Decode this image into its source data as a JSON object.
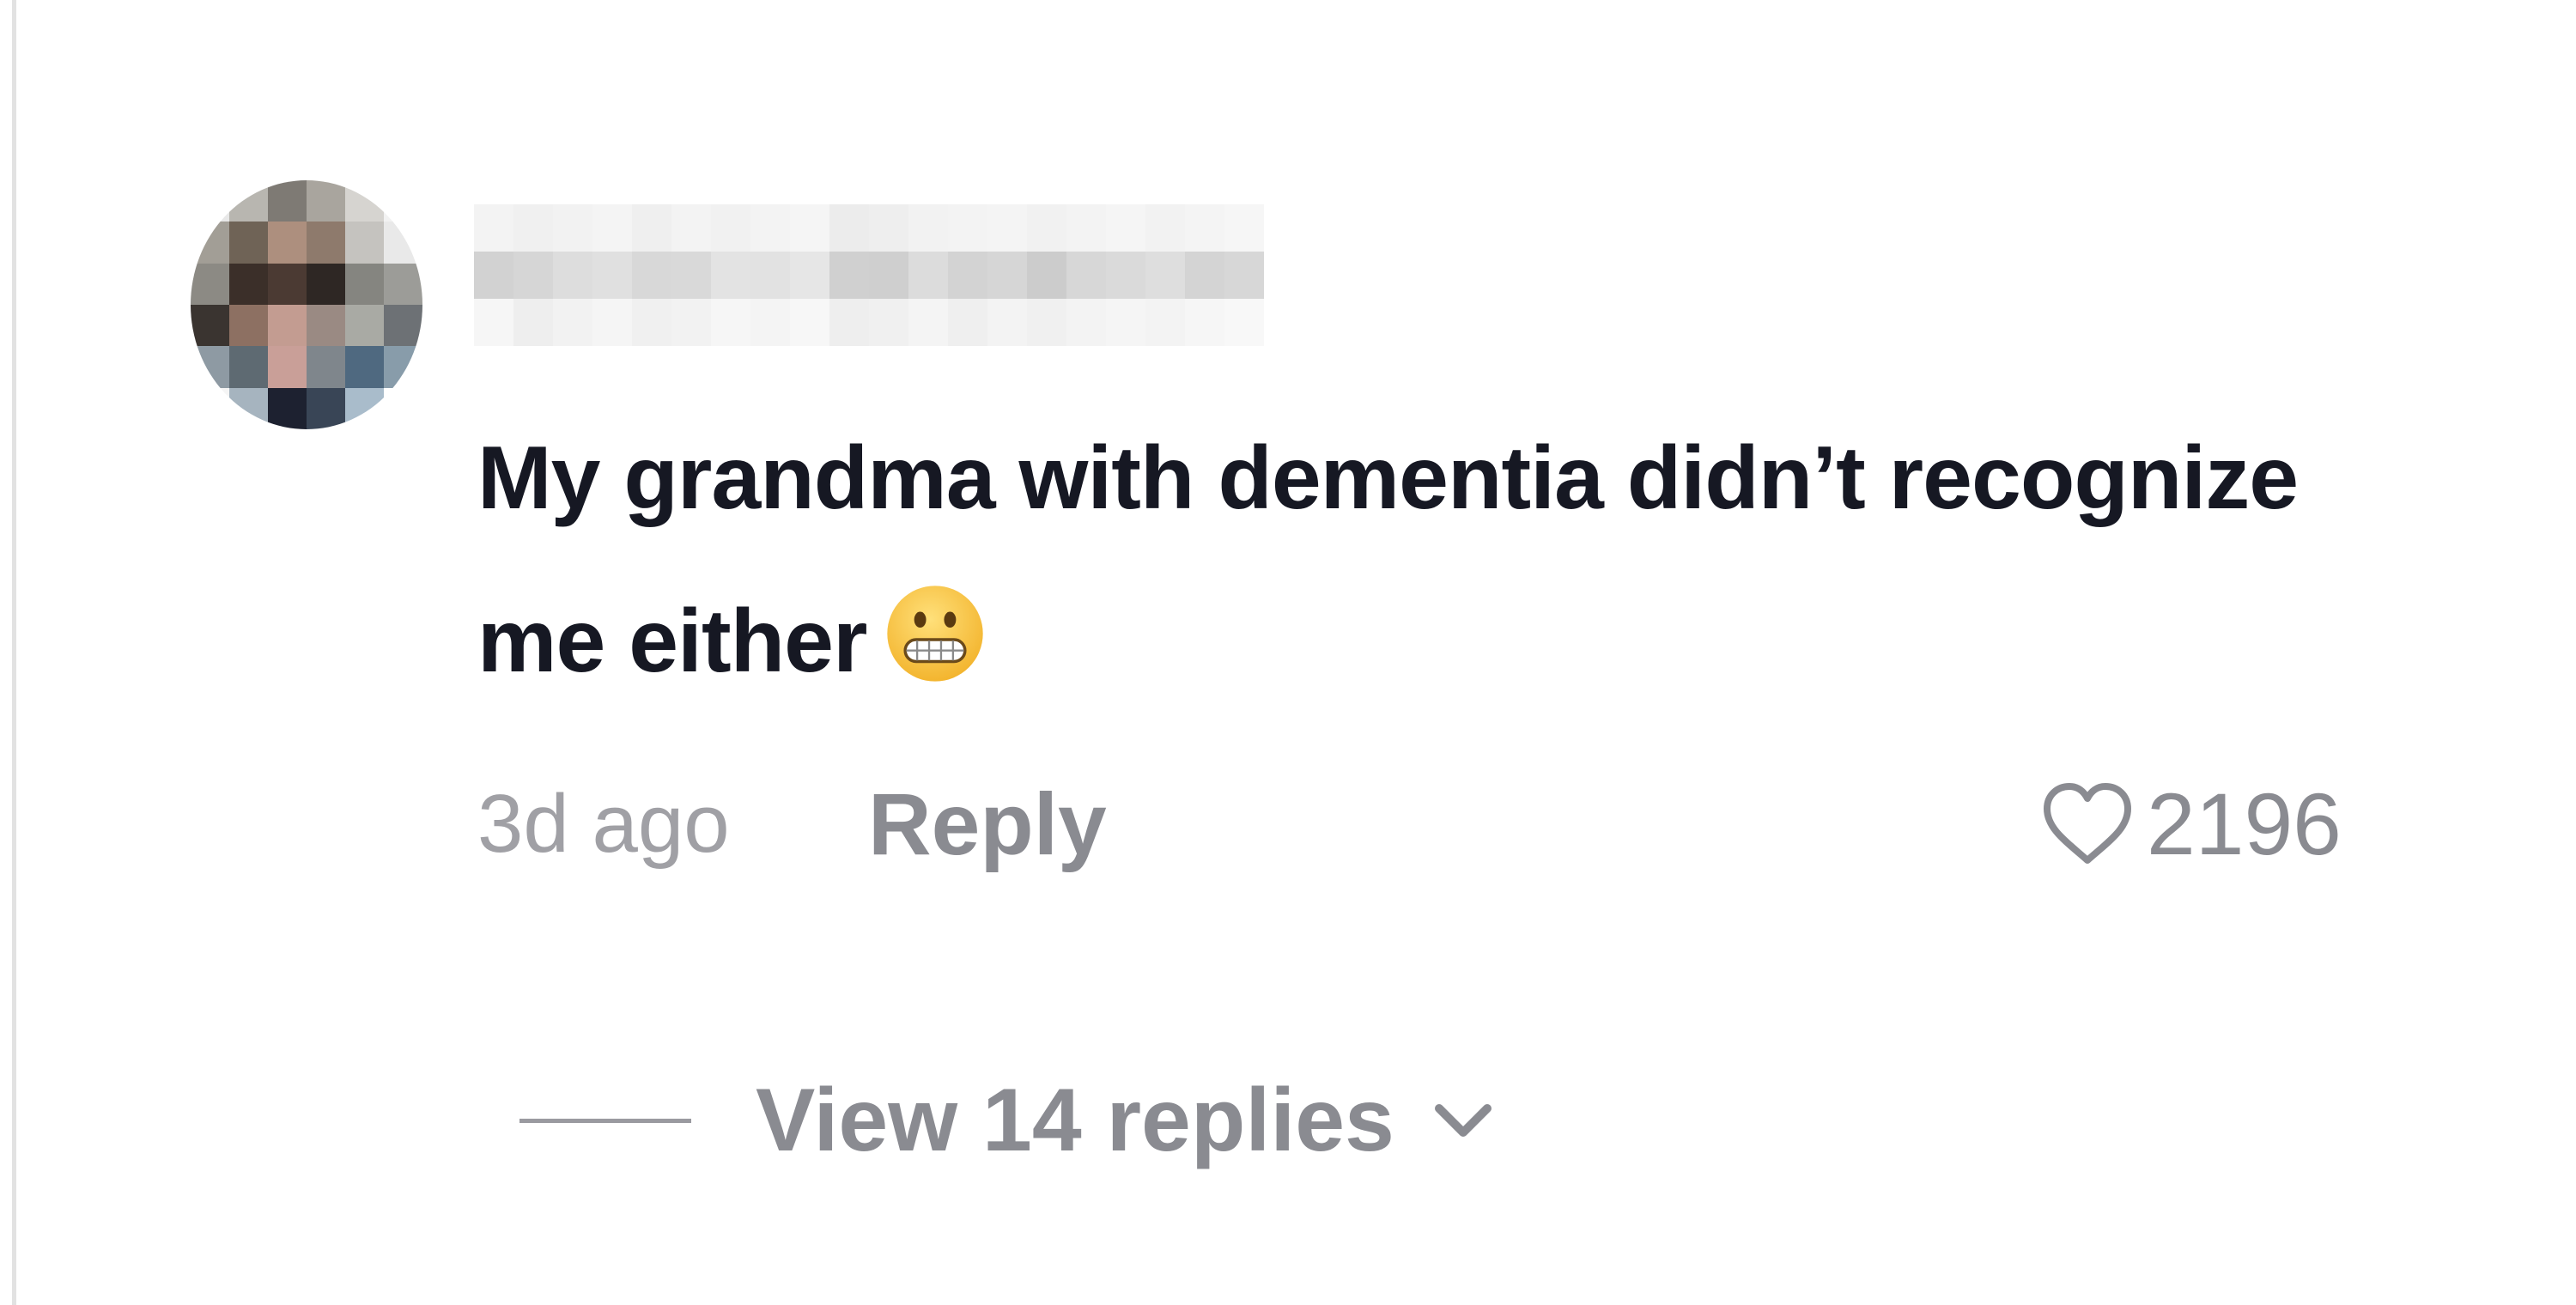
{
  "comment": {
    "username": "",
    "text": "My grandma with dementia didn’t recognize me either",
    "emoji_icon": "grimacing-face-icon",
    "timestamp": "3d ago",
    "reply_label": "Reply",
    "like_icon": "heart-outline-icon",
    "like_count": "2196",
    "view_replies_label": "View 14 replies",
    "view_replies_icon": "chevron-down-icon"
  },
  "colors": {
    "text_primary": "#161823",
    "text_secondary": "#8a8b91",
    "emoji_face": "#f6c443"
  }
}
